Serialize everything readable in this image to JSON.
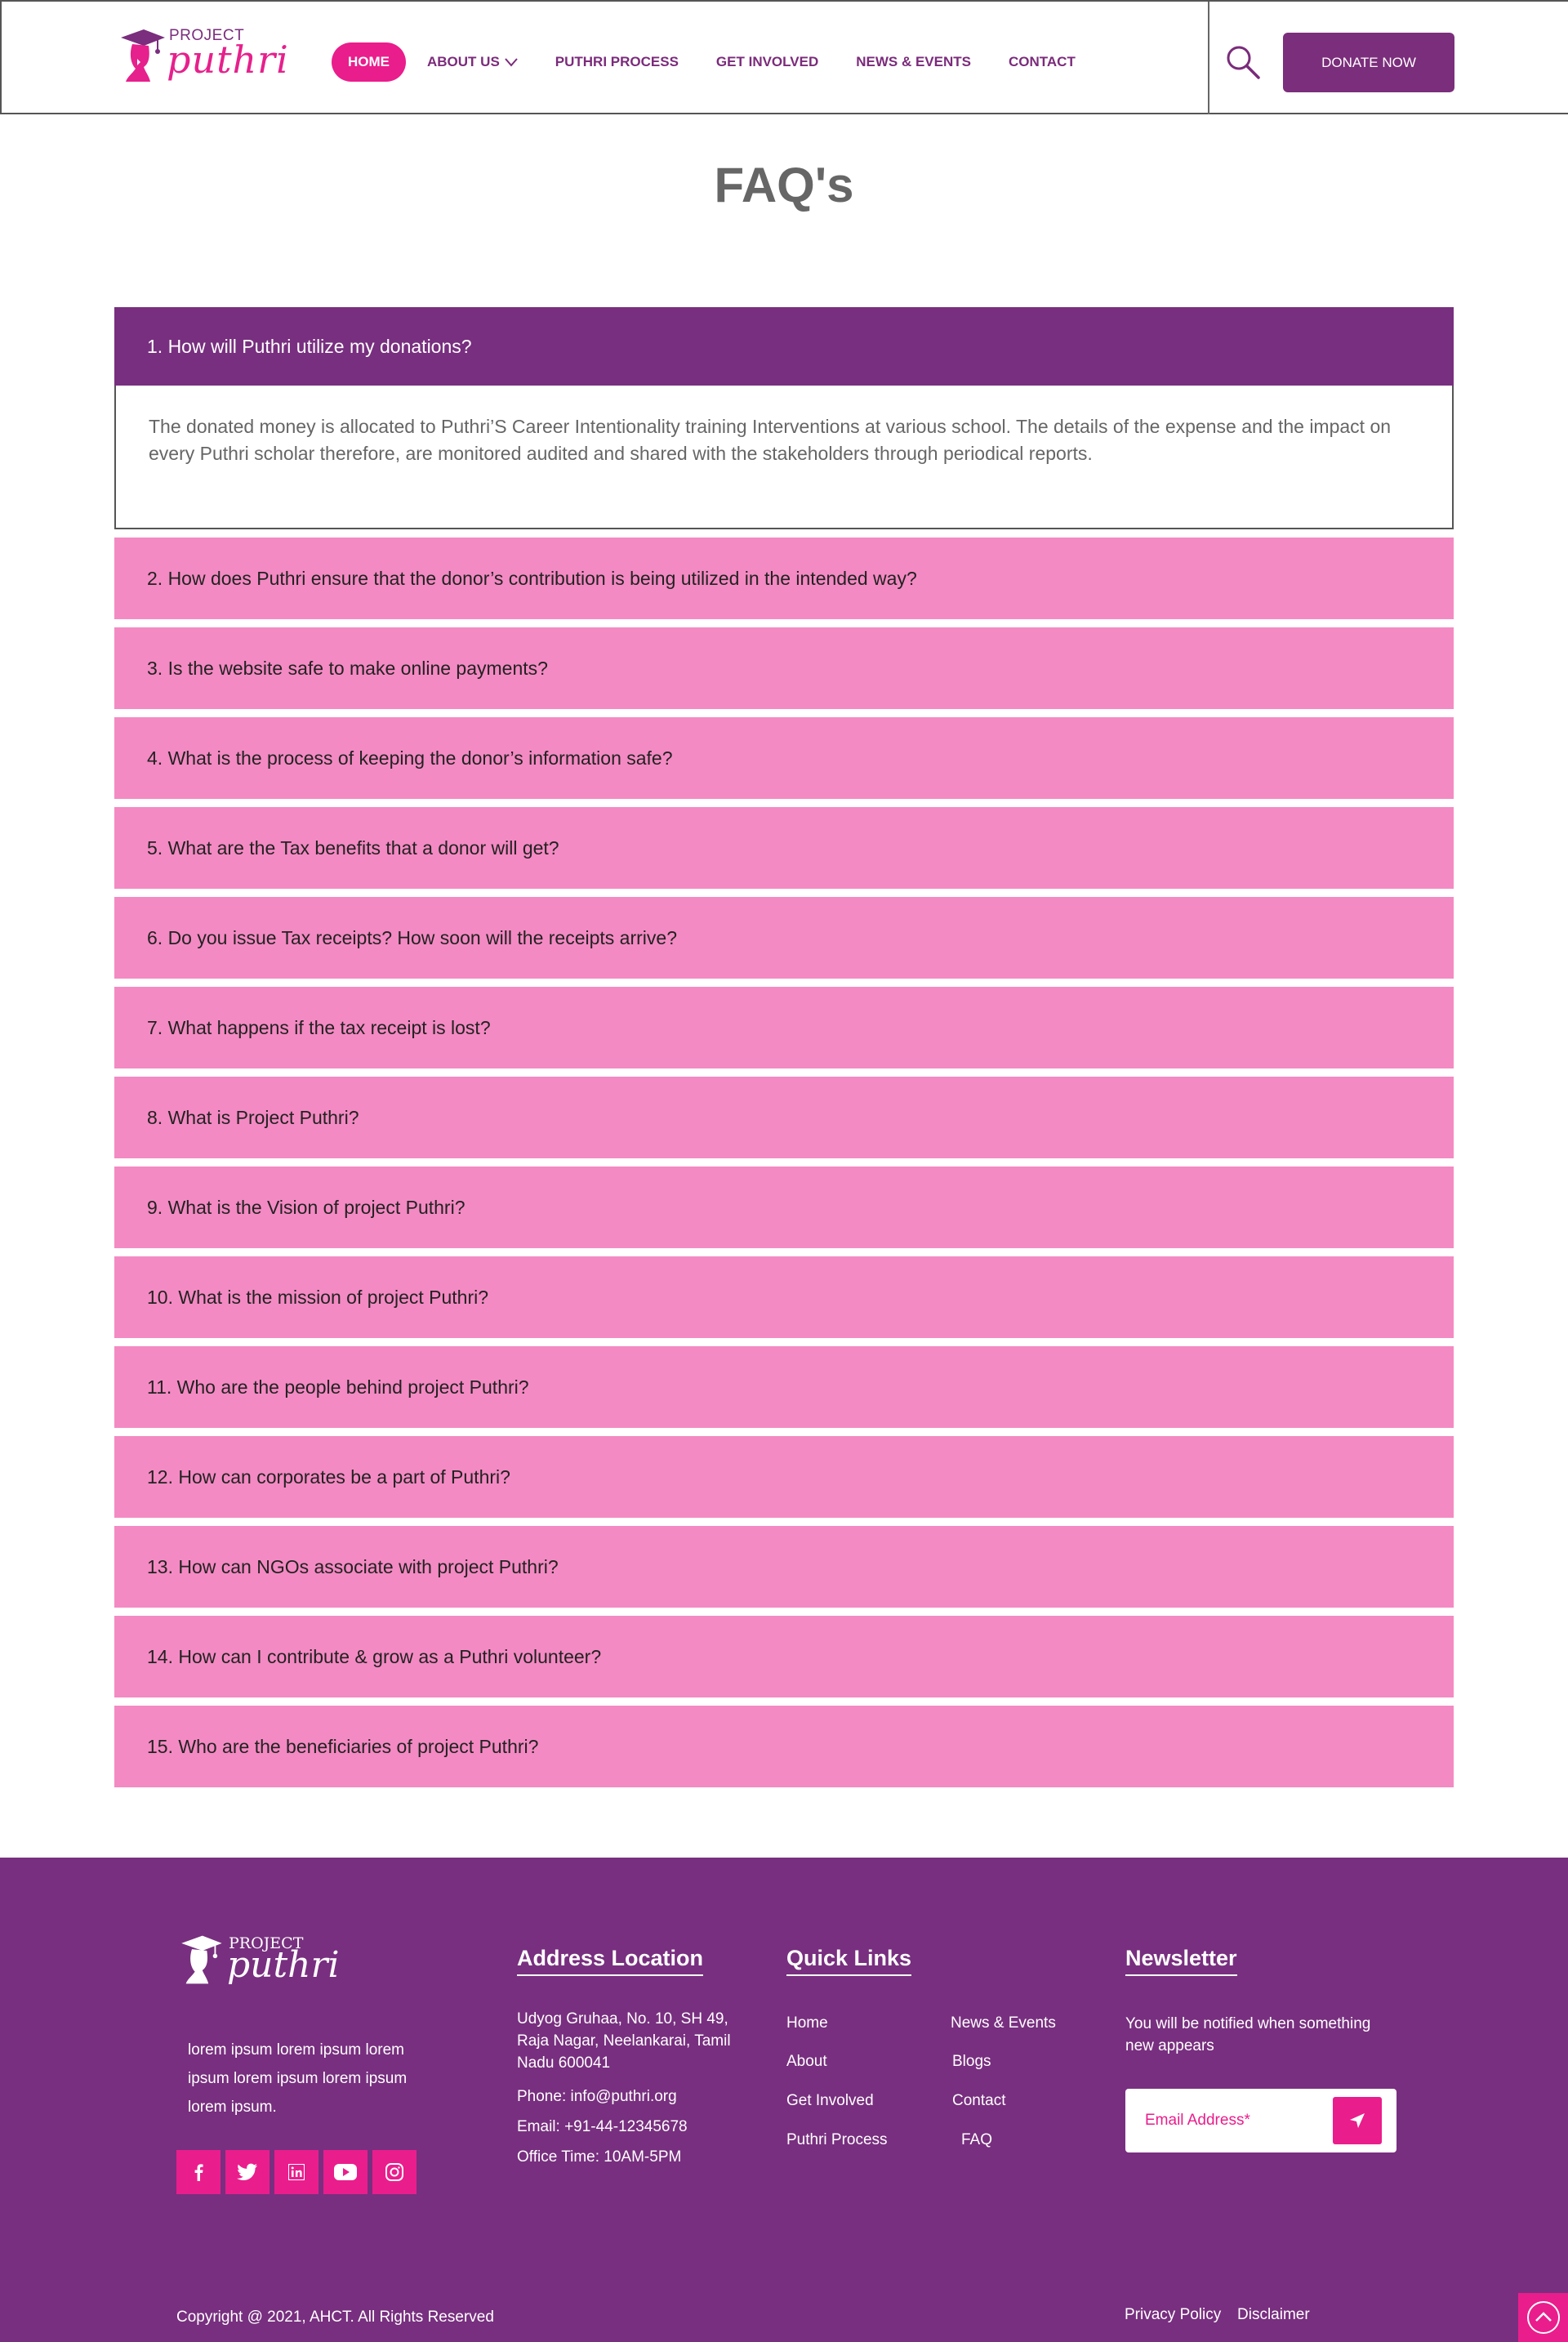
{
  "brand": {
    "logo_small": "PROJECT",
    "logo_big": "puthri",
    "accent_color": "#ea1d8c",
    "primary_color": "#782f7f"
  },
  "nav": {
    "items": [
      {
        "label": "HOME",
        "active": true
      },
      {
        "label": "ABOUT US",
        "has_dropdown": true
      },
      {
        "label": "PUTHRI PROCESS"
      },
      {
        "label": "GET INVOLVED"
      },
      {
        "label": "NEWS & EVENTS"
      },
      {
        "label": "CONTACT"
      }
    ],
    "search_icon": "search-icon",
    "donate_label": "DONATE NOW"
  },
  "page": {
    "title": "FAQ's"
  },
  "faq": {
    "open": {
      "question": "1. How will Puthri utilize my donations?",
      "answer": "The donated money is allocated to Puthri’S Career Intentionality training Interventions at various school. The details of the expense and the impact on every Puthri scholar therefore, are monitored audited and shared with the stakeholders through periodical reports."
    },
    "items": [
      "2. How does Puthri ensure that the donor’s contribution is being utilized in the intended way?",
      "3. Is the website safe to make online payments?",
      "4. What is the process of keeping the donor’s information safe?",
      "5. What are the Tax benefits that a donor will get?",
      "6. Do you issue Tax receipts? How soon will the receipts arrive?",
      "7. What happens if the tax receipt is lost?",
      "8. What is Project Puthri?",
      "9. What is the Vision of project Puthri?",
      "10. What is the mission of project Puthri?",
      "11. Who are the people behind project Puthri?",
      "12. How can corporates be a part of Puthri?",
      "13. How can NGOs associate with project Puthri?",
      "14. How can I contribute & grow as a Puthri volunteer?",
      "15. Who are the beneficiaries of project Puthri?"
    ]
  },
  "footer": {
    "logo_small": "PROJECT",
    "logo_big": "puthri",
    "about": "lorem ipsum lorem ipsum lorem ipsum lorem ipsum lorem ipsum lorem ipsum.",
    "socials": [
      "facebook-icon",
      "twitter-icon",
      "linkedin-icon",
      "youtube-icon",
      "instagram-icon"
    ],
    "address_heading": "Address Location",
    "address": "Udyog Gruhaa, No. 10, SH 49, Raja Nagar, Neelankarai, Tamil Nadu 600041",
    "phone": "Phone: info@puthri.org",
    "email": "Email: +91-44-12345678",
    "office_time": "Office Time: 10AM-5PM",
    "quick_links_heading": "Quick Links",
    "quick_links_col1": [
      "Home",
      "About",
      "Get Involved",
      "Puthri Process"
    ],
    "quick_links_col2": [
      "News & Events",
      "Blogs",
      "Contact",
      "FAQ"
    ],
    "newsletter_heading": "Newsletter",
    "newsletter_text": "You will be notified when something new appears",
    "email_placeholder": "Email Address*",
    "copyright": "Copyright @ 2021, AHCT. All Rights Reserved",
    "privacy": "Privacy Policy",
    "disclaimer": "Disclaimer"
  }
}
